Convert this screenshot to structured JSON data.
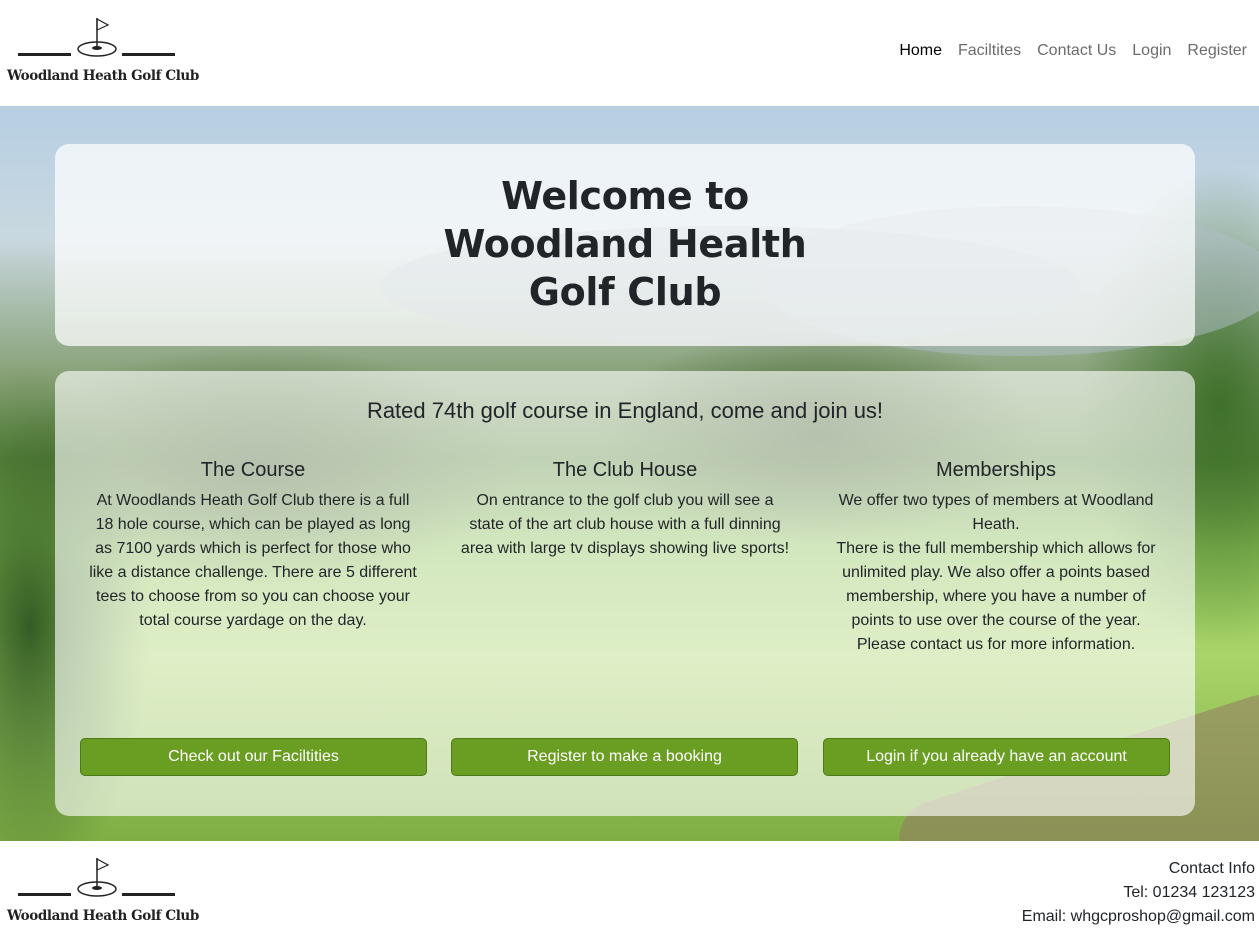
{
  "header": {
    "logo_text": "Woodland Heath Golf Club",
    "nav": [
      {
        "label": "Home"
      },
      {
        "label": "Faciltites"
      },
      {
        "label": "Contact Us"
      },
      {
        "label": "Login"
      },
      {
        "label": "Register"
      }
    ],
    "active_nav": "Home"
  },
  "hero": {
    "title_line1": "Welcome to",
    "title_line2": "Woodland Health",
    "title_line3": "Golf Club",
    "tagline": "Rated 74th golf course in England, come and join us!",
    "columns": [
      {
        "heading": "The Course",
        "text": "At Woodlands Heath Golf Club there is a full 18 hole course, which can be played as long as 7100 yards which is perfect for those who like a distance challenge. There are 5 different tees to choose from so you can choose your total course yardage on the day."
      },
      {
        "heading": "The Club House",
        "text": "On entrance to the golf club you will see a state of the art club house with a full dinning area with large tv displays showing live sports!"
      },
      {
        "heading": "Memberships",
        "text_line1": "We offer two types of members at Woodland Heath.",
        "text_line2": "There is the full membership which allows for unlimited play. We also offer a points based membership, where you have a number of points to use over the course of the year.",
        "text_line3": "Please contact us for more information."
      }
    ],
    "buttons": [
      {
        "label": "Check out our Faciltities"
      },
      {
        "label": "Register to make a booking"
      },
      {
        "label": "Login if you already have an account"
      }
    ]
  },
  "footer": {
    "logo_text": "Woodland Heath Golf Club",
    "contact_title": "Contact Info",
    "tel": "Tel: 01234 123123",
    "email": "Email: whgcproshop@gmail.com"
  },
  "colors": {
    "button_green": "#6a9e22",
    "text_dark": "#212529",
    "nav_muted": "#6c6c6c"
  }
}
